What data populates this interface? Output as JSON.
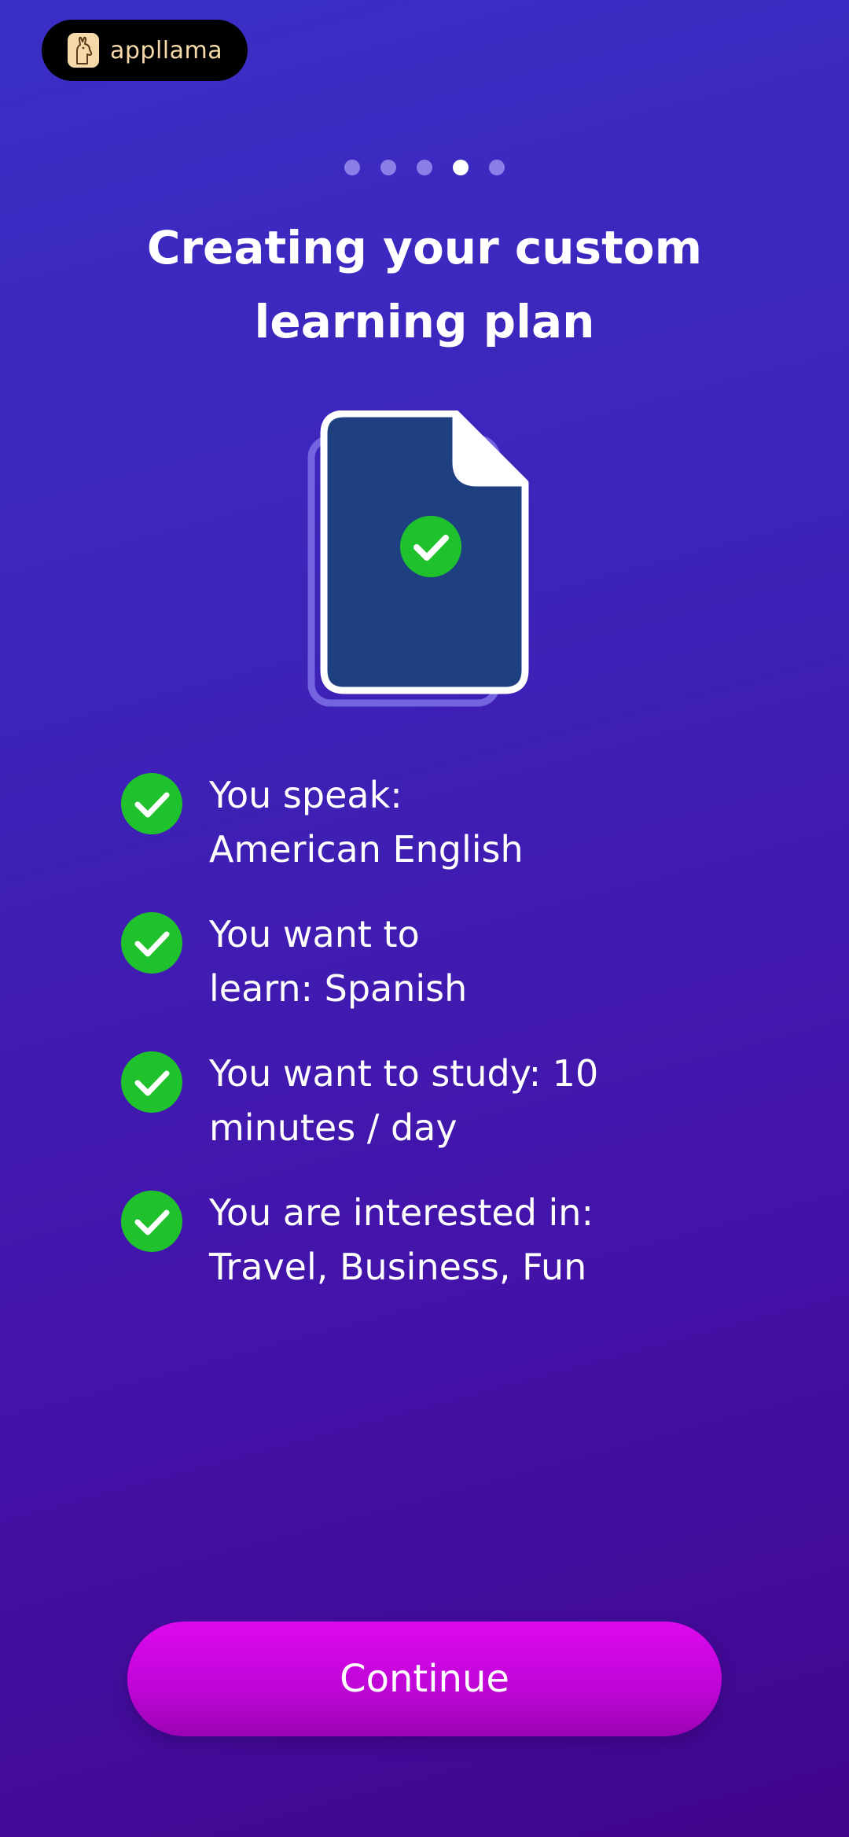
{
  "brand": {
    "name": "appllama",
    "icon": "llama-icon"
  },
  "progress": {
    "total_steps": 5,
    "current_step": 4
  },
  "title": {
    "line1": "Creating your custom",
    "line2": "learning plan"
  },
  "illustration": {
    "icon": "document-check-icon",
    "doc_fill": "#1f4080",
    "check_color": "#1fc22c"
  },
  "checklist": {
    "items": [
      {
        "line1": "You speak:",
        "line2": "American English"
      },
      {
        "line1": "You want to",
        "line2": "learn: Spanish"
      },
      {
        "line1": "You want to study: 10",
        "line2": "minutes / day"
      },
      {
        "line1": "You are interested in:",
        "line2": "Travel, Business, Fun"
      }
    ]
  },
  "continue_button": {
    "label": "Continue"
  },
  "colors": {
    "background_top": "#3b2fc6",
    "background_bottom": "#40058c",
    "accent_button": "#d307e6",
    "check_green": "#1fc22c"
  }
}
